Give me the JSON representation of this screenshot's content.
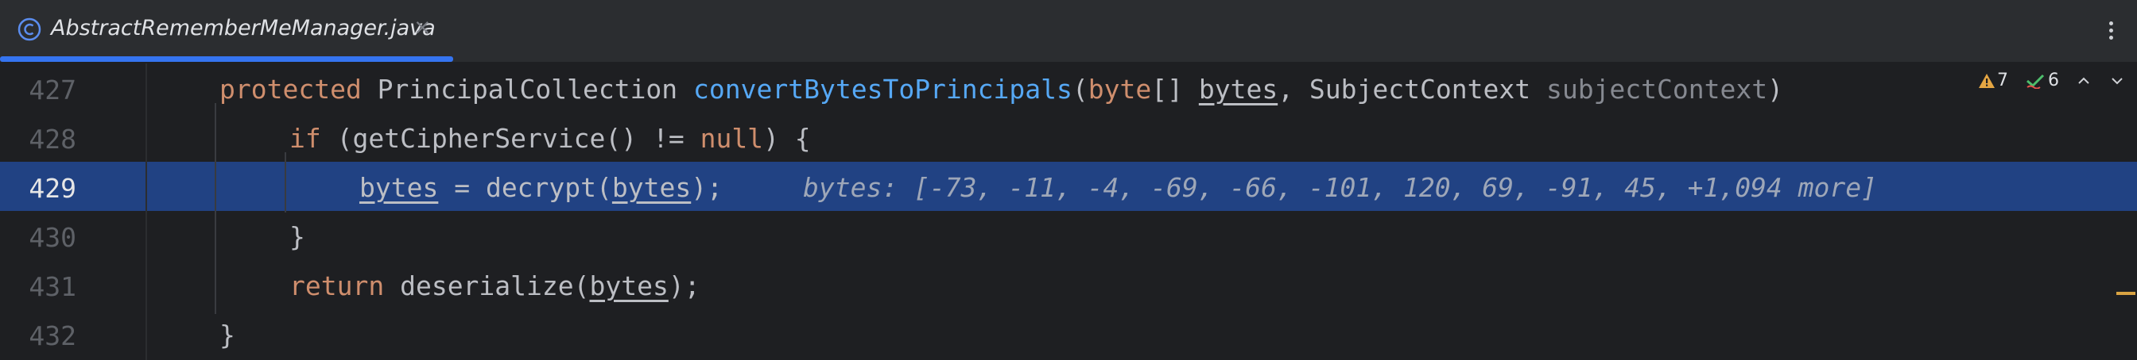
{
  "tab": {
    "title": "AbstractRememberMeManager.java",
    "icon": "class-icon",
    "close_glyph": "×"
  },
  "inspections": {
    "warnings": "7",
    "checks": "6",
    "warning_color": "#e5a643",
    "check_color": "#4dbe6c"
  },
  "editor": {
    "current_line": "429",
    "lines": [
      {
        "number": "427",
        "tokens": {
          "kw": "protected",
          "t1": " PrincipalCollection ",
          "fn": "convertBytesToPrincipals",
          "t2": "(",
          "kw2": "byte",
          "t3": "[] ",
          "p1": "bytes",
          "t4": ", SubjectContext ",
          "p2": "subjectContext",
          "t5": ")"
        }
      },
      {
        "number": "428",
        "tokens": {
          "kw": "if",
          "t1": " (getCipherService() != ",
          "kw2": "null",
          "t2": ") {"
        }
      },
      {
        "number": "429",
        "tokens": {
          "p1": "bytes",
          "t1": " = decrypt(",
          "p2": "bytes",
          "t2": ");"
        },
        "inline_hint": "bytes: [-73, -11, -4, -69, -66, -101, 120, 69, -91, 45, +1,094 more]"
      },
      {
        "number": "430",
        "tokens": {
          "t1": "}"
        }
      },
      {
        "number": "431",
        "tokens": {
          "kw": "return",
          "t1": " deserialize(",
          "p1": "bytes",
          "t2": ");"
        }
      },
      {
        "number": "432",
        "tokens": {
          "t1": "}"
        }
      }
    ]
  },
  "colors": {
    "background": "#1e1f22",
    "tabbar": "#2b2d30",
    "accent": "#3574f0",
    "current_line": "#214283",
    "keyword": "#cf8e6d",
    "method": "#56a8f5",
    "text": "#bcbec4"
  }
}
